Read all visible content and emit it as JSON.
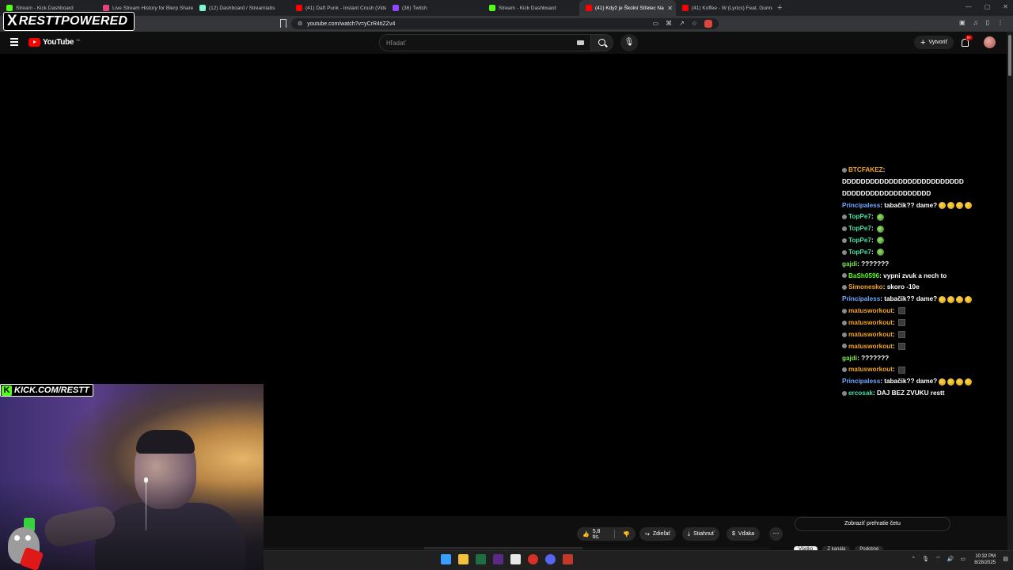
{
  "browser": {
    "tabs": [
      {
        "title": "Stream - Kick Dashboard",
        "favicon_color": "#53fc18",
        "active": false
      },
      {
        "title": "Live Stream History for Blerp Shares",
        "favicon_color": "#e0457b",
        "active": false
      },
      {
        "title": "(12) Dashboard / Streamlabs",
        "favicon_color": "#80f5d2",
        "active": false
      },
      {
        "title": "(41) Daft Punk - Instant Crush (Vide",
        "favicon_color": "#ff0000",
        "active": false
      },
      {
        "title": "(36) Twitch",
        "favicon_color": "#9146ff",
        "active": false
      },
      {
        "title": "Stream - Kick Dashboard",
        "favicon_color": "#53fc18",
        "active": false
      },
      {
        "title": "(41) Když je Školní Střelec Na",
        "favicon_color": "#ff0000",
        "active": true
      },
      {
        "title": "(41) Koffee - W (Lyrics) Feat. Gunna",
        "favicon_color": "#ff0000",
        "active": false
      }
    ],
    "url": "youtube.com/watch?v=yCrR4tiZZv4"
  },
  "youtube": {
    "logo_text": "YouTube",
    "region": "SK",
    "search_placeholder": "Hľadať",
    "create_label": "Vytvoriť",
    "notifications_badge": "9+"
  },
  "chat": {
    "messages": [
      {
        "user": "BTCFAKEZ",
        "text": "",
        "color": "#f5a623",
        "badge": true,
        "emotes": []
      },
      {
        "user": "",
        "text": "DDDDDDDDDDDDDDDDDDDDDDDDDD",
        "color": "#ffffff",
        "badge": false,
        "emotes": []
      },
      {
        "user": "",
        "text": "DDDDDDDDDDDDDDDDDDD",
        "color": "#ffffff",
        "badge": false,
        "emotes": []
      },
      {
        "user": "Principaless",
        "text": "tabačik?? dame?",
        "color": "#6fa8ff",
        "badge": false,
        "emotes": [
          "think",
          "think",
          "think",
          "think"
        ]
      },
      {
        "user": "TopPe7",
        "text": "",
        "color": "#45e0b0",
        "badge": true,
        "emotes": [
          "pepe"
        ]
      },
      {
        "user": "TopPe7",
        "text": "",
        "color": "#45e0b0",
        "badge": true,
        "emotes": [
          "pepe"
        ]
      },
      {
        "user": "TopPe7",
        "text": "",
        "color": "#45e0b0",
        "badge": true,
        "emotes": [
          "pepe"
        ]
      },
      {
        "user": "TopPe7",
        "text": "",
        "color": "#45e0b0",
        "badge": true,
        "emotes": [
          "pepe"
        ]
      },
      {
        "user": "gajdi",
        "text": "???????",
        "color": "#7ee84f",
        "badge": false,
        "emotes": []
      },
      {
        "user": "BaSh0596",
        "text": "vypni zvuk a nech to",
        "color": "#53fc18",
        "badge": true,
        "emotes": []
      },
      {
        "user": "Simonesko",
        "text": "skoro -10e",
        "color": "#f5a623",
        "badge": true,
        "emotes": []
      },
      {
        "user": "Principaless",
        "text": "tabačik?? dame?",
        "color": "#6fa8ff",
        "badge": false,
        "emotes": [
          "think",
          "think",
          "think",
          "think"
        ]
      },
      {
        "user": "matusworkout",
        "text": "",
        "color": "#f5a623",
        "badge": true,
        "emotes": [
          "block"
        ]
      },
      {
        "user": "matusworkout",
        "text": "",
        "color": "#f5a623",
        "badge": true,
        "emotes": [
          "block"
        ]
      },
      {
        "user": "matusworkout",
        "text": "",
        "color": "#f5a623",
        "badge": true,
        "emotes": [
          "block"
        ]
      },
      {
        "user": "matusworkout",
        "text": "",
        "color": "#f5a623",
        "badge": true,
        "emotes": [
          "block"
        ]
      },
      {
        "user": "gajdi",
        "text": "???????",
        "color": "#7ee84f",
        "badge": false,
        "emotes": []
      },
      {
        "user": "matusworkout",
        "text": "",
        "color": "#f5a623",
        "badge": true,
        "emotes": [
          "block"
        ]
      },
      {
        "user": "Principaless",
        "text": "tabačik?? dame?",
        "color": "#6fa8ff",
        "badge": false,
        "emotes": [
          "think",
          "think",
          "think",
          "think"
        ]
      },
      {
        "user": "ercosak",
        "text": "DAJ BEZ ZVUKU restt",
        "color": "#45e0b0",
        "badge": true,
        "emotes": []
      }
    ]
  },
  "actions": {
    "like_count": "5,8 tis.",
    "share_label": "Zdieľať",
    "download_label": "Stiahnuť",
    "thanks_label": "Vďaka",
    "chat_replay_label": "Zobraziť prehratie četu",
    "chips": [
      "Všetko",
      "Z kanála",
      "Podobné"
    ]
  },
  "overlay": {
    "brand_x": "X",
    "brand_text": "RESTTPOWERED",
    "kick_k": "K",
    "kick_text": "KICK.COM/RESTT"
  },
  "taskbar": {
    "icons": [
      {
        "name": "windows-start-icon",
        "color": "#3aa0ff"
      },
      {
        "name": "file-explorer-icon",
        "color": "#f3c13a"
      },
      {
        "name": "excel-icon",
        "color": "#1d6f42"
      },
      {
        "name": "obs-icon",
        "color": "#5b2a86"
      },
      {
        "name": "notepad-icon",
        "color": "#e8e8e8"
      },
      {
        "name": "chrome-icon",
        "color": "#d93025"
      },
      {
        "name": "discord-icon",
        "color": "#5865f2"
      },
      {
        "name": "streamer-app-icon",
        "color": "#c0392b"
      }
    ],
    "time": "10:32 PM",
    "date": "8/28/2025"
  }
}
